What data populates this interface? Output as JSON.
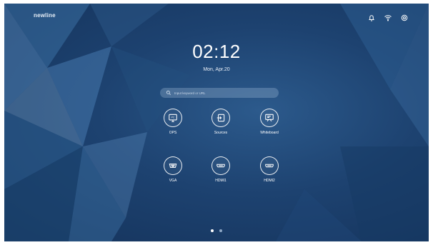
{
  "brand": "newline",
  "status_icons": [
    "bell-icon",
    "wifi-icon",
    "settings-icon"
  ],
  "time": "02:12",
  "date": "Mon, Apr.20",
  "search": {
    "placeholder": "Input keyword or URL",
    "icon": "search-icon"
  },
  "apps": [
    {
      "label": "OPS",
      "icon": "ops-pc-icon"
    },
    {
      "label": "Sources",
      "icon": "sources-icon"
    },
    {
      "label": "Whiteboard",
      "icon": "whiteboard-icon"
    },
    {
      "label": "VGA",
      "icon": "vga-icon"
    },
    {
      "label": "HDMI1",
      "icon": "hdmi-icon"
    },
    {
      "label": "HDMI2",
      "icon": "hdmi-icon"
    }
  ],
  "pager": {
    "pages": 2,
    "current": 1
  },
  "colors": {
    "background": "#1d4270",
    "text": "#ffffff",
    "search_bg": "#a8c2de"
  }
}
